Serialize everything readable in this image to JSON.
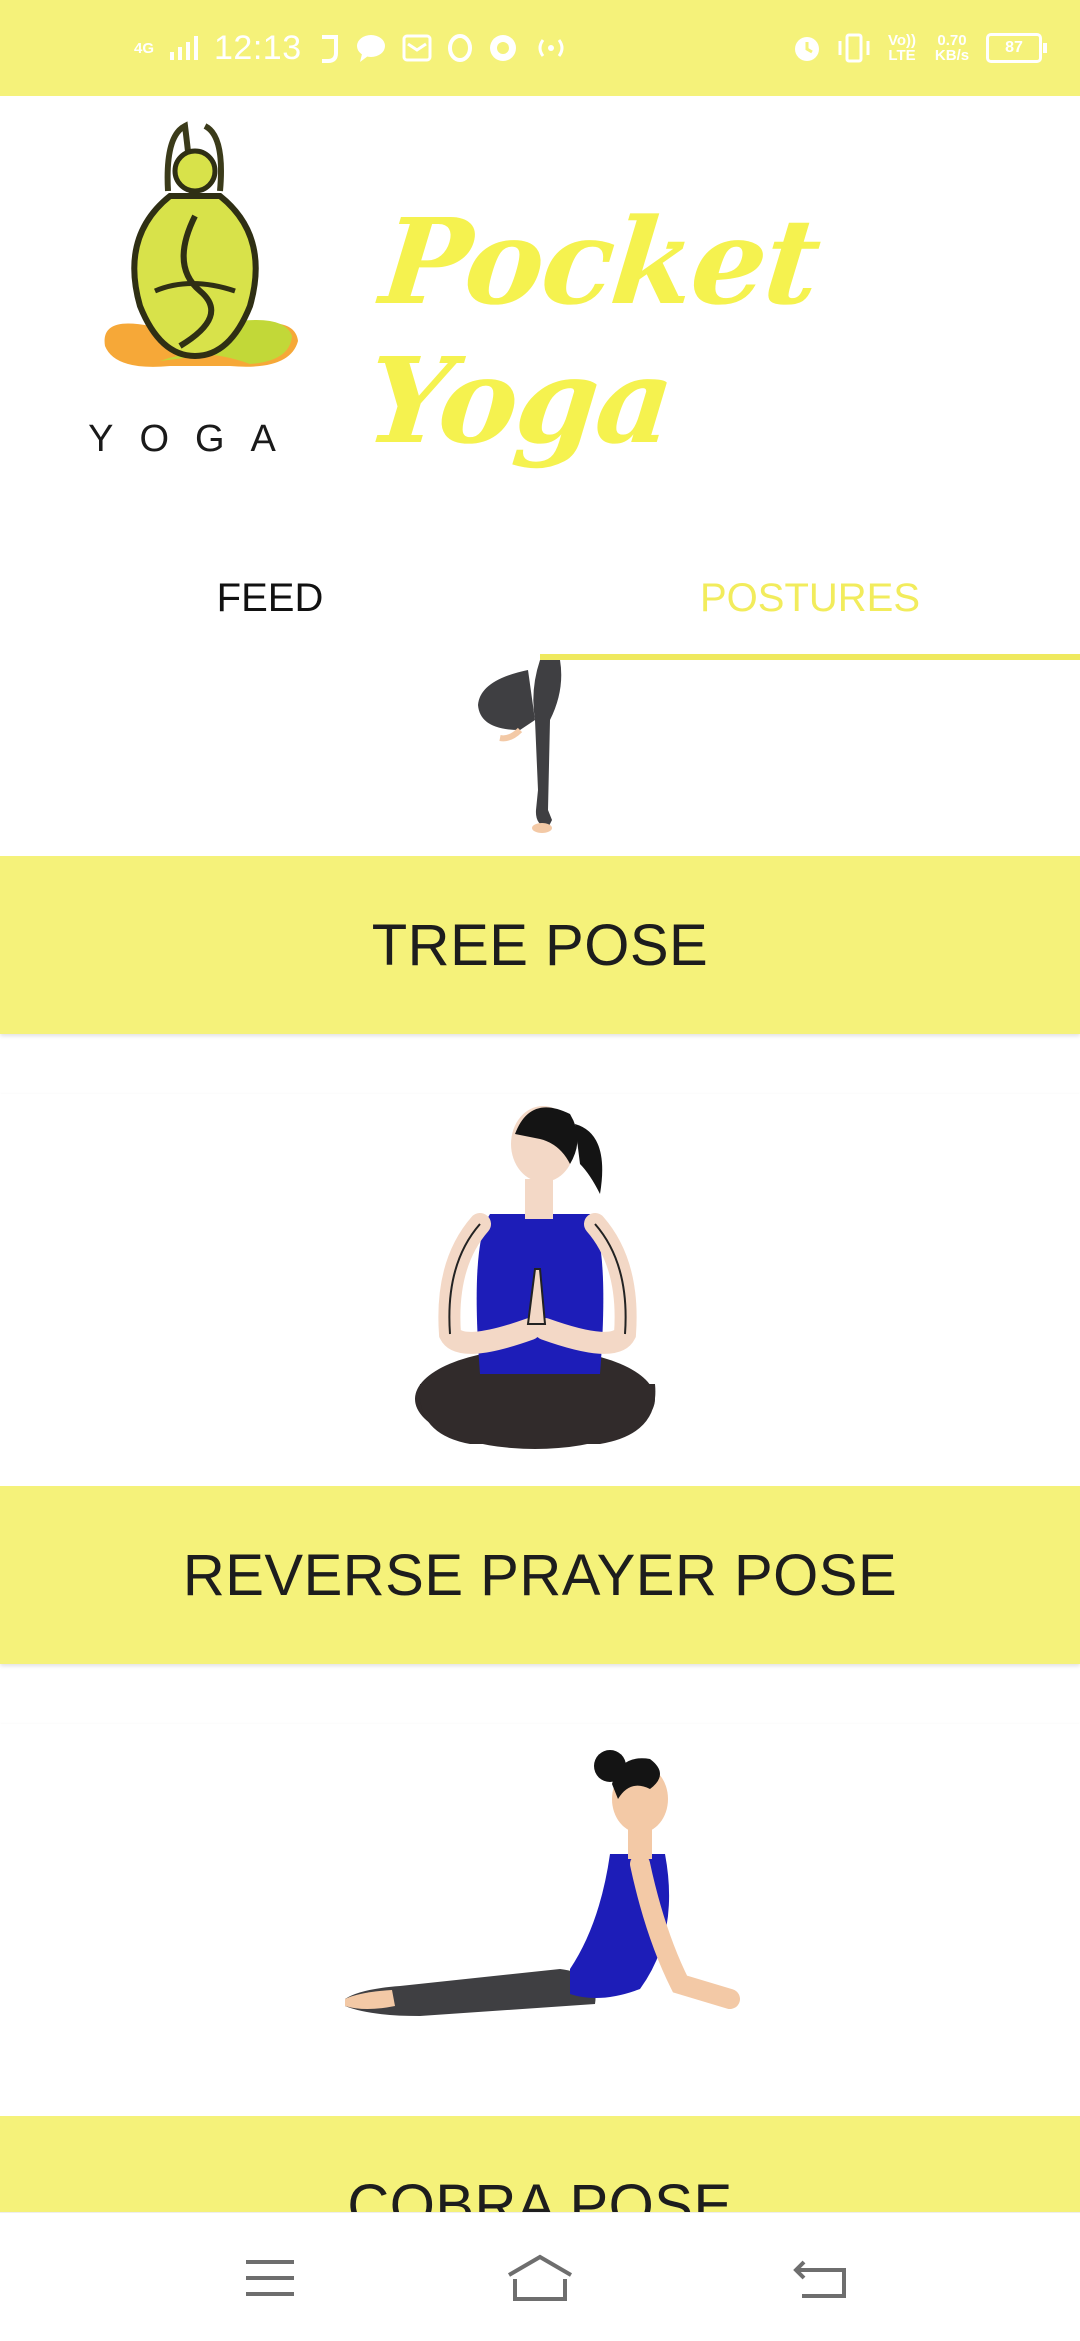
{
  "status_bar": {
    "network": "4G",
    "time": "12:13",
    "volte": "Vo)) LTE",
    "speed": "0.70 KB/s",
    "battery": "87"
  },
  "header": {
    "logo_text": "YOGA",
    "title": "Pocket Yoga"
  },
  "tabs": [
    {
      "label": "FEED",
      "selected": false
    },
    {
      "label": "POSTURES",
      "selected": true
    }
  ],
  "postures": [
    {
      "label": "TREE POSE"
    },
    {
      "label": "REVERSE PRAYER POSE"
    },
    {
      "label": "COBRA POSE"
    }
  ],
  "colors": {
    "accent_yellow": "#f5f27a",
    "title_yellow": "#f5f24f",
    "tab_selected": "#f2ec5c"
  }
}
